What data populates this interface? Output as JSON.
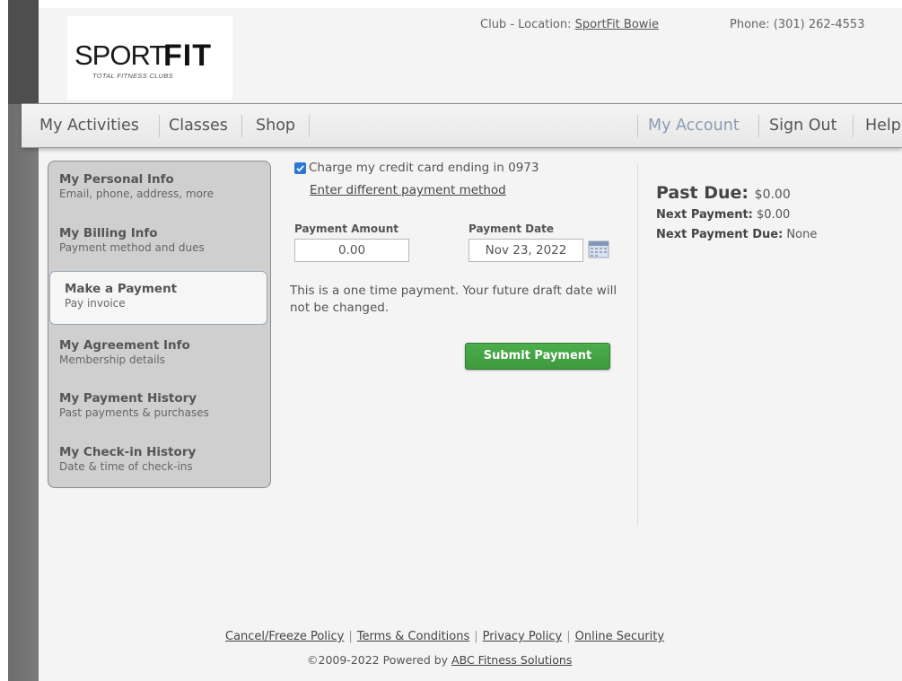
{
  "header": {
    "logo": {
      "word1": "SPORT",
      "word2": "FIT",
      "tagline": "TOTAL FITNESS CLUBS"
    },
    "club_location_label": "Club - Location: ",
    "club_location_value": "SportFit Bowie",
    "phone": "Phone: (301) 262-4553"
  },
  "nav": {
    "left": [
      "My Activities",
      "Classes",
      "Shop"
    ],
    "right": [
      "My Account",
      "Sign Out",
      "Help"
    ],
    "active": "My Account"
  },
  "sidebar": {
    "items": [
      {
        "title": "My Personal Info",
        "subtitle": "Email, phone, address, more"
      },
      {
        "title": "My Billing Info",
        "subtitle": "Payment method and dues"
      },
      {
        "title": "Make a Payment",
        "subtitle": "Pay invoice"
      },
      {
        "title": "My Agreement Info",
        "subtitle": "Membership details"
      },
      {
        "title": "My Payment History",
        "subtitle": "Past payments & purchases"
      },
      {
        "title": "My Check-in History",
        "subtitle": "Date & time of check-ins"
      }
    ],
    "selected": "Make a Payment"
  },
  "payment": {
    "charge_card_label": "Charge my credit card ending in 0973",
    "charge_card_checked": true,
    "different_method_link": "Enter different payment method",
    "amount_label": "Payment Amount",
    "amount_value": "0.00",
    "date_label": "Payment Date",
    "date_value": "Nov 23, 2022",
    "note": "This is a one time payment. Your future draft date will not be changed.",
    "submit_label": "Submit Payment",
    "submit_color": "#46a745"
  },
  "summary": {
    "past_due_label": "Past Due:",
    "past_due_value": "$0.00",
    "next_payment_label": "Next Payment:",
    "next_payment_value": "$0.00",
    "next_payment_due_label": "Next Payment Due:",
    "next_payment_due_value": "None"
  },
  "footer": {
    "links": [
      "Cancel/Freeze Policy",
      "Terms & Conditions",
      "Privacy Policy",
      "Online Security"
    ],
    "copyright_prefix": "©2009-2022 Powered by ",
    "copyright_link": "ABC Fitness Solutions"
  }
}
